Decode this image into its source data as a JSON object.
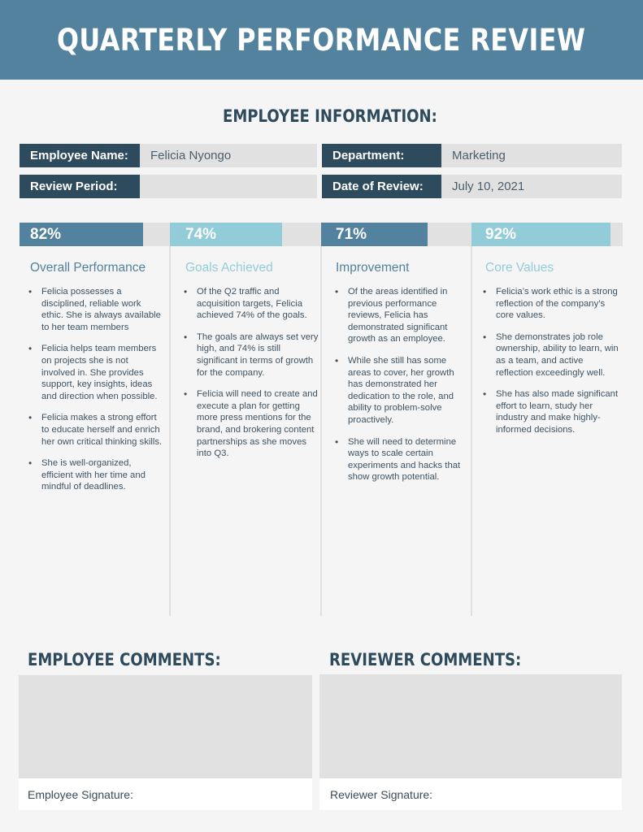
{
  "header": {
    "title": "QUARTERLY PERFORMANCE REVIEW"
  },
  "employee_info": {
    "title": "EMPLOYEE INFORMATION:",
    "fields": [
      {
        "label": "Employee Name:",
        "value": "Felicia Nyongo"
      },
      {
        "label": "Department:",
        "value": "Marketing"
      },
      {
        "label": "Review Period:",
        "value": ""
      },
      {
        "label": "Date of Review:",
        "value": "July 10, 2021"
      }
    ]
  },
  "metrics": [
    {
      "percent_label": "82%",
      "percent": 82,
      "title": "Overall Performance",
      "color": "#52829d",
      "bullets": [
        "Felicia possesses a disciplined, reliable work ethic. She is always available to her team members",
        "Felicia helps team members on projects she is not involved in. She provides support, key insights, ideas and direction when possible.",
        "Felicia makes a strong effort to educate herself and enrich her own critical thinking skills.",
        "She is well-organized, efficient with her time and mindful of deadlines."
      ]
    },
    {
      "percent_label": "74%",
      "percent": 74,
      "title": "Goals Achieved",
      "color": "#93ccd9",
      "bullets": [
        "Of the Q2 traffic and acquisition targets, Felicia achieved 74% of the goals.",
        "The goals are always set very high, and 74% is still significant in terms of growth for the company.",
        "Felicia will need to create and execute a plan for getting more press mentions for the brand, and brokering content partnerships as she moves into Q3."
      ]
    },
    {
      "percent_label": "71%",
      "percent": 71,
      "title": "Improvement",
      "color": "#52829d",
      "bullets": [
        "Of the areas identified in previous performance reviews, Felicia has demonstrated significant growth as an employee.",
        "While she still has some areas to cover, her growth has demonstrated her dedication to the role, and ability to problem-solve proactively.",
        "She will need to determine ways to scale certain experiments and hacks that show growth potential."
      ]
    },
    {
      "percent_label": "92%",
      "percent": 92,
      "title": "Core Values",
      "color": "#93ccd9",
      "bullets": [
        "Felicia’s work ethic is a strong reflection of the company’s core values.",
        "She demonstrates job role ownership, ability to learn, win as a team, and active reflection exceedingly well.",
        "She has also made significant effort to learn, study her industry and make highly-informed decisions."
      ]
    }
  ],
  "comments": {
    "employee": {
      "title": "EMPLOYEE COMMENTS:",
      "text": "",
      "signature_label": "Employee Signature:"
    },
    "reviewer": {
      "title": "REVIEWER COMMENTS:",
      "text": "",
      "signature_label": "Reviewer Signature:"
    }
  }
}
